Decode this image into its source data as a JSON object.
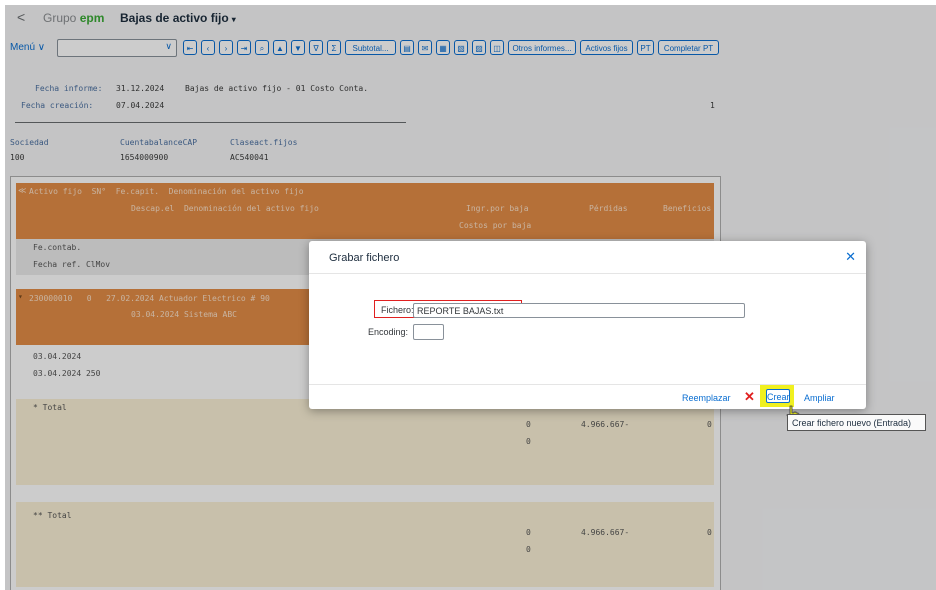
{
  "shell": {
    "back": "<",
    "brand_prefix": "Grupo ",
    "brand_name": "epm",
    "app_title": "Bajas de activo fijo",
    "app_title_caret": "▾"
  },
  "toolbar": {
    "menu_label": "Menú ∨",
    "menu_select_caret": "∨",
    "icon_buttons": [
      "first-page-icon",
      "prev-page-icon",
      "next-page-icon",
      "last-page-icon",
      "find-icon",
      "sort-ascending-icon",
      "sort-descending-icon",
      "filter-icon",
      "sum-icon"
    ],
    "subtotal": "Subtotal...",
    "icon_buttons_2": [
      "layout-icon",
      "mail-icon",
      "spreadsheet-icon",
      "export-icon",
      "print-icon",
      "details-icon"
    ],
    "otros_informes": "Otros informes...",
    "activos_fijos": "Activos fijos",
    "pt": "PT",
    "completar_pt": "Completar PT"
  },
  "report": {
    "fecha_informe_label": "Fecha informe:",
    "fecha_informe_value": "31.12.2024",
    "report_title": "Bajas de activo fijo - 01 Costo Conta.",
    "fecha_creacion_label": "Fecha creación:",
    "fecha_creacion_value": "07.04.2024",
    "page_number": "1",
    "col_sociedad": "Sociedad",
    "col_cuenta": "CuentabalanceCAP",
    "col_clase": "Claseact.fijos",
    "val_sociedad": "100",
    "val_cuenta": "1654000900",
    "val_clase": "AC540041",
    "hdr_row1": "Activo fijo  SN°  Fe.capit.  Denominación del activo fijo",
    "hdr_row2": "Descap.el  Denominación del activo fijo",
    "hdr_ingr": "Ingr.por baja",
    "hdr_perdidas": "Pérdidas",
    "hdr_beneficios": "Beneficios",
    "hdr_costos": "Costos por baja",
    "sub_fe_contab": "Fe.contab.",
    "sub_fecha_ref": "Fecha ref. ClMov",
    "data_row1": "230000010   0   27.02.2024 Actuador Electrico # 90",
    "data_row2": "03.04.2024 Sistema ABC",
    "date_row1": "03.04.2024",
    "date_row2": "03.04.2024 250",
    "total1_label": "* Total",
    "total1_zero_a": "0",
    "total1_loss": "4.966.667-",
    "total1_zero_b": "0",
    "total1_zero_c": "0",
    "total2_label": "** Total",
    "total2_zero_a": "0",
    "total2_loss": "4.966.667-",
    "total2_zero_b": "0",
    "total2_zero_c": "0"
  },
  "dialog": {
    "title": "Grabar fichero",
    "close": "✕",
    "fichero_label": "Fichero:",
    "fichero_value": "REPORTE BAJAS.txt",
    "encoding_label": "Encoding:",
    "encoding_value": "",
    "reemplazar": "Reemplazar",
    "cancel_icon": "✕",
    "crear": "Crear",
    "ampliar": "Ampliar"
  },
  "tooltip": "Crear fichero nuevo (Entrada)",
  "colors": {
    "accent": "#0a6ed1",
    "header_orange": "#e38d46",
    "highlight_red": "#e02020",
    "highlight_yellow": "#f0f020",
    "total_row": "#fbf1d6"
  }
}
